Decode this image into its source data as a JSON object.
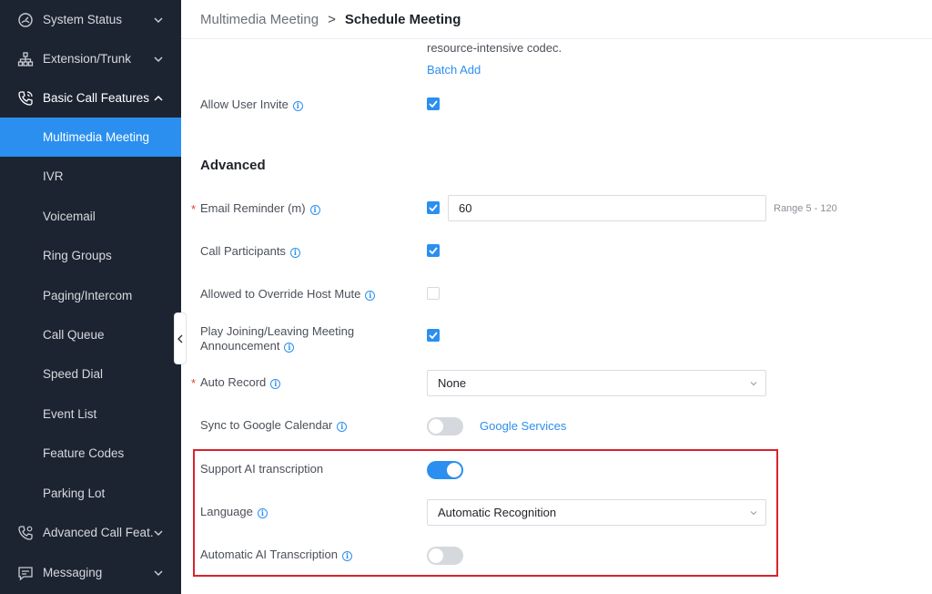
{
  "sidebar": {
    "items": [
      {
        "label": "System Status",
        "icon": "gauge-icon",
        "expand": "chevron-down"
      },
      {
        "label": "Extension/Trunk",
        "icon": "network-icon",
        "expand": "chevron-down"
      },
      {
        "label": "Basic Call Features",
        "icon": "phone-icon",
        "expand": "chevron-up"
      },
      {
        "label": "Multimedia Meeting"
      },
      {
        "label": "IVR"
      },
      {
        "label": "Voicemail"
      },
      {
        "label": "Ring Groups"
      },
      {
        "label": "Paging/Intercom"
      },
      {
        "label": "Call Queue"
      },
      {
        "label": "Speed Dial"
      },
      {
        "label": "Event List"
      },
      {
        "label": "Feature Codes"
      },
      {
        "label": "Parking Lot"
      },
      {
        "label": "Advanced Call Feat...",
        "icon": "phone-settings-icon",
        "expand": "chevron-down"
      },
      {
        "label": "Messaging",
        "icon": "message-icon",
        "expand": "chevron-down"
      }
    ],
    "active_item": "Multimedia Meeting"
  },
  "breadcrumb": {
    "parent": "Multimedia Meeting",
    "separator": ">",
    "current": "Schedule Meeting"
  },
  "form": {
    "codec_note": "resource-intensive codec.",
    "batch_add": "Batch Add",
    "allow_user_invite": {
      "label": "Allow User Invite",
      "checked": true
    },
    "advanced_title": "Advanced",
    "email_reminder": {
      "label": "Email Reminder (m)",
      "required": true,
      "checked": true,
      "value": "60",
      "range": "Range 5 - 120"
    },
    "call_participants": {
      "label": "Call Participants",
      "checked": true
    },
    "override_host_mute": {
      "label": "Allowed to Override Host Mute",
      "checked": false
    },
    "play_announcement": {
      "label_line1": "Play Joining/Leaving Meeting",
      "label_line2": "Announcement",
      "checked": true
    },
    "auto_record": {
      "label": "Auto Record",
      "required": true,
      "value": "None"
    },
    "sync_google": {
      "label": "Sync to Google Calendar",
      "enabled": false,
      "link": "Google Services"
    },
    "support_ai": {
      "label": "Support AI transcription",
      "enabled": true
    },
    "language": {
      "label": "Language",
      "value": "Automatic Recognition"
    },
    "auto_ai": {
      "label": "Automatic AI Transcription",
      "enabled": false
    }
  },
  "colors": {
    "sidebar_bg": "#1d2431",
    "accent": "#2b8ff0",
    "highlight_border": "#d9232d"
  }
}
